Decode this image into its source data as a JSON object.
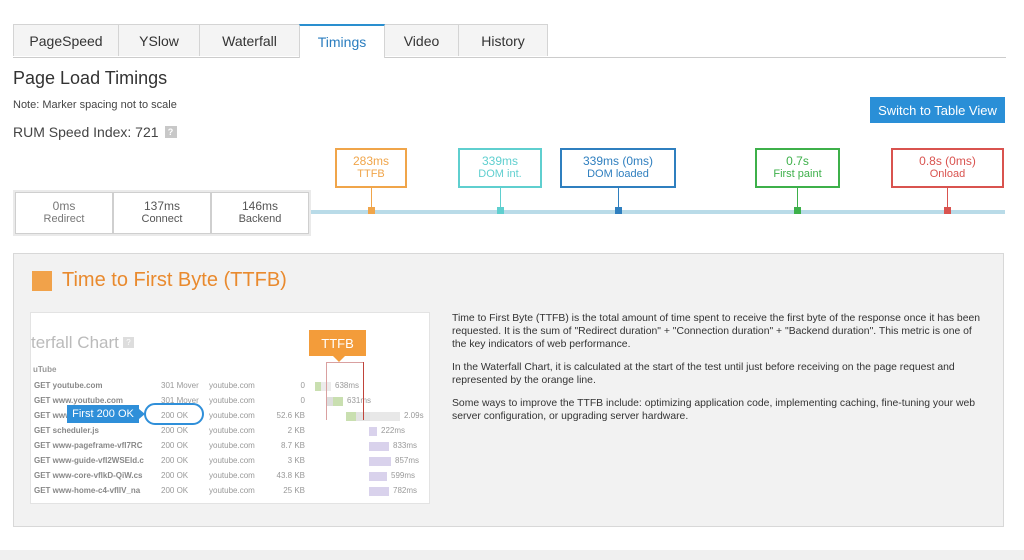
{
  "tabs": [
    {
      "label": "PageSpeed",
      "active": false
    },
    {
      "label": "YSlow",
      "active": false
    },
    {
      "label": "Waterfall",
      "active": false
    },
    {
      "label": "Timings",
      "active": true
    },
    {
      "label": "Video",
      "active": false
    },
    {
      "label": "History",
      "active": false
    }
  ],
  "header": {
    "title": "Page Load Timings",
    "note": "Note: Marker spacing not to scale",
    "rum_label": "RUM Speed Index: 721",
    "help": "?",
    "switch_button": "Switch to Table View"
  },
  "segments": [
    {
      "value": "0ms",
      "label": "Redirect"
    },
    {
      "value": "137ms",
      "label": "Connect"
    },
    {
      "value": "146ms",
      "label": "Backend"
    }
  ],
  "markers": [
    {
      "value": "283ms",
      "label": "TTFB",
      "color": "#f0a54a"
    },
    {
      "value": "339ms",
      "label": "DOM int.",
      "color": "#5fcfcf"
    },
    {
      "value": "339ms (0ms)",
      "label": "DOM loaded",
      "color": "#2f7fbf"
    },
    {
      "value": "0.7s",
      "label": "First paint",
      "color": "#3db04a"
    },
    {
      "value": "0.8s (0ms)",
      "label": "Onload",
      "color": "#d9534f"
    }
  ],
  "panel": {
    "title": "Time to First Byte (TTFB)",
    "accent": "#f1a24a",
    "paragraphs": [
      "Time to First Byte (TTFB) is the total amount of time spent to receive the first byte of the response once it has been requested. It is the sum of \"Redirect duration\" + \"Connection duration\" + \"Backend duration\". This metric is one of the key indicators of web performance.",
      "In the Waterfall Chart, it is calculated at the start of the test until just before receiving on the page request and represented by the orange line.",
      "Some ways to improve the TTFB include: optimizing application code, implementing caching, fine-tuning your web server configuration, or upgrading server hardware."
    ]
  },
  "waterfall": {
    "title": "terfall Chart",
    "help": "?",
    "group": "uTube",
    "ttfb_tag": "TTFB",
    "first_ok": "First 200 OK",
    "rows": [
      {
        "request": "GET youtube.com",
        "status": "301 Mover",
        "domain": "youtube.com",
        "size": "0",
        "time": "638ms"
      },
      {
        "request": "GET www.youtube.com",
        "status": "301 Mover",
        "domain": "youtube.com",
        "size": "0",
        "time": "631ms"
      },
      {
        "request": "GET www",
        "status": "200 OK",
        "domain": "youtube.com",
        "size": "52.6 KB",
        "time": "2.09s"
      },
      {
        "request": "GET scheduler.js",
        "status": "200 OK",
        "domain": "youtube.com",
        "size": "2 KB",
        "time": "222ms"
      },
      {
        "request": "GET www-pageframe-vfl7RC",
        "status": "200 OK",
        "domain": "youtube.com",
        "size": "8.7 KB",
        "time": "833ms"
      },
      {
        "request": "GET www-guide-vfl2WSEld.c",
        "status": "200 OK",
        "domain": "youtube.com",
        "size": "3 KB",
        "time": "857ms"
      },
      {
        "request": "GET www-core-vflkD-QiW.cs",
        "status": "200 OK",
        "domain": "youtube.com",
        "size": "43.8 KB",
        "time": "599ms"
      },
      {
        "request": "GET www-home-c4-vflIV_na",
        "status": "200 OK",
        "domain": "youtube.com",
        "size": "25 KB",
        "time": "782ms"
      }
    ]
  }
}
